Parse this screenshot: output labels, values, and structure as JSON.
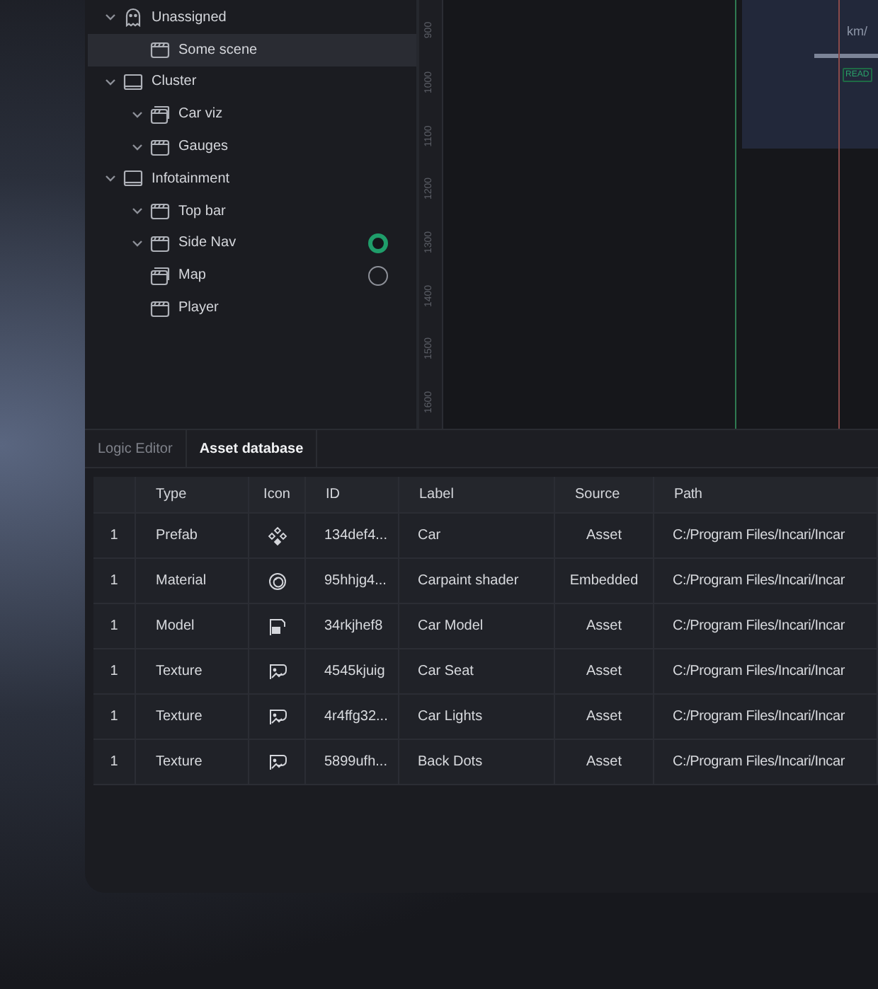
{
  "tree": [
    {
      "label": "Unassigned",
      "kind": "ghost",
      "expanded": true,
      "selected": false,
      "children": [
        {
          "label": "Some scene",
          "kind": "scene",
          "selected": true
        }
      ]
    },
    {
      "label": "Cluster",
      "kind": "screen",
      "expanded": true,
      "selected": false,
      "children": [
        {
          "label": "Car viz",
          "kind": "scene-stack",
          "expanded": true,
          "selected": false
        },
        {
          "label": "Gauges",
          "kind": "scene",
          "expanded": true,
          "selected": false
        }
      ]
    },
    {
      "label": "Infotainment",
      "kind": "screen",
      "expanded": true,
      "selected": false,
      "children": [
        {
          "label": "Top bar",
          "kind": "scene",
          "expanded": true,
          "selected": false
        },
        {
          "label": "Side Nav",
          "kind": "scene",
          "expanded": true,
          "selected": false,
          "toggle": true
        },
        {
          "label": "Map",
          "kind": "scene-stack",
          "selected": false,
          "toggle": false
        },
        {
          "label": "Player",
          "kind": "scene",
          "selected": false
        }
      ]
    }
  ],
  "ruler": [
    "900",
    "1000",
    "1100",
    "1200",
    "1300",
    "1400",
    "1500",
    "1600"
  ],
  "canvas_card": {
    "unit": "km/",
    "badge": "READ"
  },
  "tabs": [
    {
      "label": "Logic Editor",
      "selected": false
    },
    {
      "label": "Asset database",
      "selected": true
    }
  ],
  "table": {
    "columns": [
      "",
      "Type",
      "Icon",
      "ID",
      "Label",
      "Source",
      "Path"
    ],
    "rows": [
      {
        "index": "1",
        "type": "Prefab",
        "kind": "prefab",
        "id": "134def4...",
        "label": "Car",
        "source": "Asset",
        "path": "C:/Program Files/Incari/Incar"
      },
      {
        "index": "1",
        "type": "Material",
        "kind": "material",
        "id": "95hhjg4...",
        "label": "Carpaint shader",
        "source": "Embedded",
        "path": "C:/Program Files/Incari/Incar"
      },
      {
        "index": "1",
        "type": "Model",
        "kind": "model",
        "id": "34rkjhef8",
        "label": "Car Model",
        "source": "Asset",
        "path": "C:/Program Files/Incari/Incar"
      },
      {
        "index": "1",
        "type": "Texture",
        "kind": "texture",
        "id": "4545kjuig",
        "label": "Car Seat",
        "source": "Asset",
        "path": "C:/Program Files/Incari/Incar"
      },
      {
        "index": "1",
        "type": "Texture",
        "kind": "texture",
        "id": "4r4ffg32...",
        "label": "Car Lights",
        "source": "Asset",
        "path": "C:/Program Files/Incari/Incar"
      },
      {
        "index": "1",
        "type": "Texture",
        "kind": "texture",
        "id": "5899ufh...",
        "label": "Back Dots",
        "source": "Asset",
        "path": "C:/Program Files/Incari/Incar"
      }
    ]
  }
}
